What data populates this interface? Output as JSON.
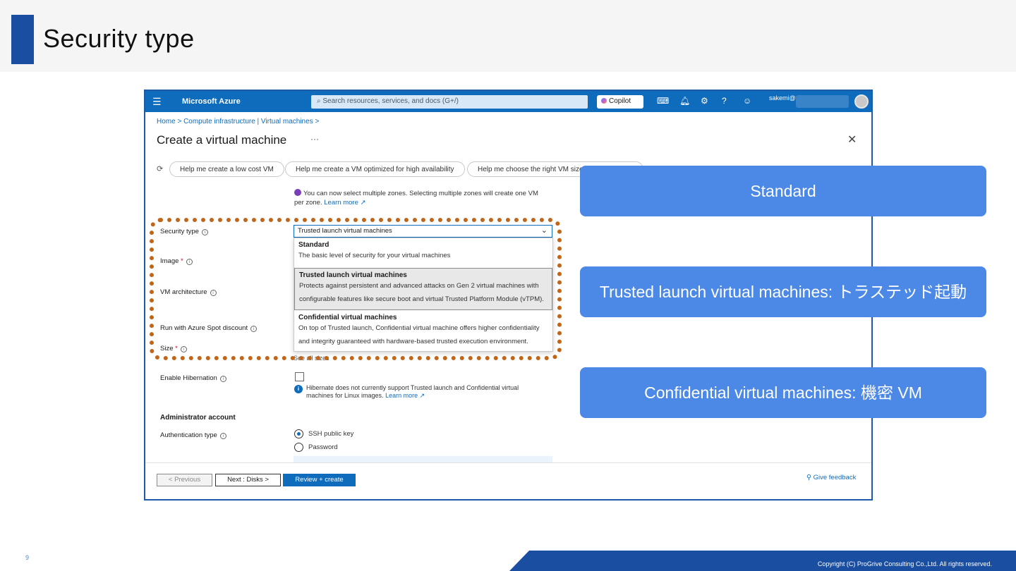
{
  "slide": {
    "title": "Security type",
    "page_number": "9",
    "copyright": "Copyright (C) ProGrive Consulting Co.,Ltd. All rights reserved.",
    "accent_color": "#1a4ea0",
    "callout_color": "#4c88e6",
    "highlight_color": "#c0661a"
  },
  "azure": {
    "brand": "Microsoft Azure",
    "search_placeholder": "Search resources, services, and docs (G+/)",
    "copilot": "Copilot",
    "user": "sakemi@",
    "breadcrumb": "Home  >  Compute infrastructure | Virtual machines  >",
    "page_title": "Create a virtual machine",
    "more": "···",
    "close": "✕",
    "chips": [
      "Help me create a low cost VM",
      "Help me create a VM optimized for high availability",
      "Help me choose the right VM size"
    ],
    "zone_note": "You can now select multiple zones. Selecting multiple zones will create one VM per zone.",
    "learn_more": "Learn more ↗",
    "fields": {
      "security_type": "Security type",
      "image": "Image",
      "vm_architecture": "VM architecture",
      "spot": "Run with Azure Spot discount",
      "size": "Size",
      "hibernation": "Enable Hibernation",
      "auth_type": "Authentication type"
    },
    "required_mark": "*",
    "security_select_value": "Trusted launch virtual machines",
    "options": [
      {
        "title": "Standard",
        "desc": "The basic level of security for your virtual machines"
      },
      {
        "title": "Trusted launch virtual machines",
        "desc1": "Protects against persistent and advanced attacks on Gen 2 virtual machines with",
        "desc2": "configurable features like secure boot and virtual Trusted Platform Module (vTPM)."
      },
      {
        "title": "Confidential virtual machines",
        "desc1": "On top of Trusted launch, Confidential virtual machine offers higher confidentiality",
        "desc2": "and integrity guaranteed with hardware-based trusted execution environment."
      }
    ],
    "below_dropdown": "See all sizes",
    "hibernation_note": "Hibernate does not currently support Trusted launch and Confidential virtual machines for Linux images.",
    "hibernation_learn_more": "Learn more ↗",
    "admin_section": "Administrator account",
    "auth_options": [
      "SSH public key",
      "Password"
    ],
    "buttons": {
      "previous": "< Previous",
      "next": "Next : Disks >",
      "review": "Review + create",
      "feedback": "Give feedback"
    }
  },
  "callouts": [
    "Standard",
    "Trusted launch virtual machines: トラステッド起動",
    "Confidential virtual machines: 機密 VM"
  ]
}
